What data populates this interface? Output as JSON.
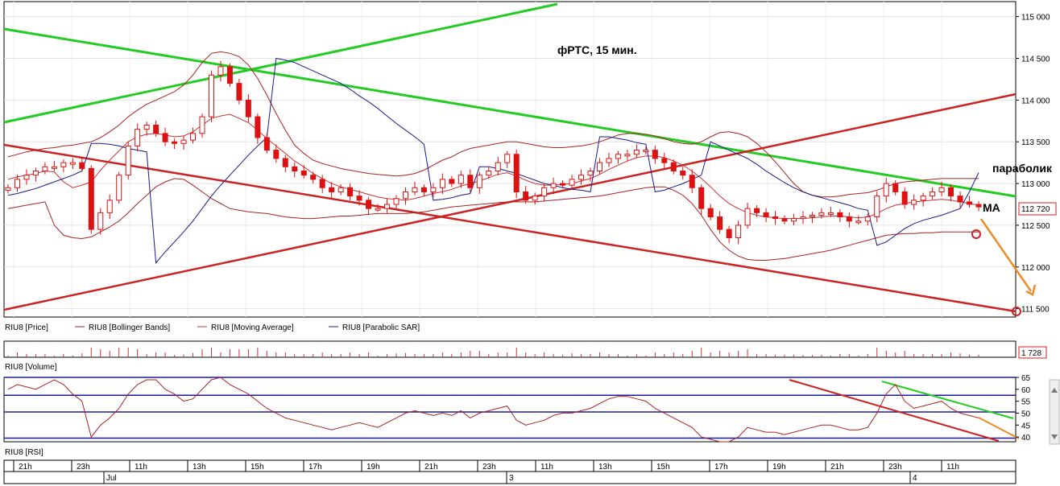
{
  "chart_data": [
    {
      "type": "candlestick",
      "title": "фРТС, 15 мин.",
      "legend": [
        "RIU8 [Price]",
        "RIU8 [Bollinger Bands]",
        "RIU8 [Moving Average]",
        "RIU8 [Parabolic SAR]"
      ],
      "y_ticks": [
        "115 000",
        "114 500",
        "114 000",
        "113 500",
        "113 000",
        "112 500",
        "112 000",
        "111 500"
      ],
      "ylim": [
        111400,
        115180
      ],
      "last_value": "112 720",
      "annotations": [
        "параболик",
        "MA"
      ],
      "colors": {
        "candles": "#dd1111",
        "bollinger": "#aa2222",
        "moving_average": "#cc3333",
        "parabolic_sar": "#1a1a8c",
        "trend_green": "#22cc22",
        "trend_red": "#cc2222",
        "forecast_arrow": "#f08a24"
      },
      "price_series": [
        112950,
        113050,
        113100,
        113150,
        113200,
        113200,
        113250,
        113250,
        113180,
        112450,
        112650,
        112800,
        113100,
        113450,
        113650,
        113700,
        113600,
        113500,
        113480,
        113520,
        113600,
        113800,
        114300,
        114400,
        114200,
        114000,
        113800,
        113550,
        113400,
        113300,
        113200,
        113150,
        113100,
        113050,
        112950,
        112900,
        112950,
        112850,
        112800,
        112700,
        112700,
        112750,
        112820,
        112900,
        112950,
        112900,
        112950,
        113050,
        113000,
        113100,
        112950,
        113100,
        113150,
        113250,
        113350,
        112900,
        112800,
        112850,
        112950,
        113000,
        112980,
        113050,
        113100,
        113150,
        113250,
        113300,
        113350,
        113350,
        113400,
        113400,
        113300,
        113250,
        113150,
        113100,
        112950,
        112700,
        112600,
        112450,
        112350,
        112500,
        112700,
        112650,
        112600,
        112580,
        112550,
        112580,
        112600,
        112620,
        112650,
        112650,
        112600,
        112550,
        112550,
        112600,
        112850,
        113000,
        112900,
        112750,
        112800,
        112850,
        112900,
        112950,
        112850,
        112780,
        112750,
        112720
      ],
      "moving_average": [
        113050,
        113080,
        113100,
        113120,
        113150,
        113140,
        113020,
        112950,
        112980,
        113020,
        113160,
        113280,
        113390,
        113500,
        113560,
        113590,
        113600,
        113580,
        113560,
        113570,
        113620,
        113700,
        113780,
        113810,
        113830,
        113780,
        113730,
        113640,
        113540,
        113450,
        113360,
        113270,
        113200,
        113120,
        113060,
        113000,
        112960,
        112930,
        112900,
        112870,
        112840,
        112820,
        112810,
        112800,
        112820,
        112850,
        112880,
        112900,
        112930,
        112970,
        113000,
        113030,
        113070,
        113110,
        113130,
        113090,
        113040,
        113000,
        112980,
        112980,
        112990,
        113000,
        113030,
        113060,
        113110,
        113170,
        113220,
        113270,
        113310,
        113330,
        113330,
        113310,
        113270,
        113220,
        113150,
        113060,
        112960,
        112850,
        112760,
        112700,
        112650,
        112620,
        112600,
        112590,
        112580,
        112580,
        112580,
        112590,
        112600,
        112610,
        112610,
        112600,
        112590,
        112600,
        112640,
        112700,
        112740,
        112760,
        112780,
        112790,
        112800,
        112810,
        112800,
        112780,
        112760,
        112740
      ],
      "bollinger_upper": [
        113320,
        113350,
        113380,
        113400,
        113420,
        113430,
        113450,
        113460,
        113480,
        113500,
        113550,
        113620,
        113700,
        113800,
        113880,
        113950,
        114000,
        114050,
        114100,
        114180,
        114300,
        114450,
        114560,
        114580,
        114560,
        114520,
        114420,
        114260,
        114060,
        113840,
        113640,
        113460,
        113360,
        113280,
        113240,
        113210,
        113180,
        113160,
        113140,
        113120,
        113110,
        113100,
        113090,
        113100,
        113120,
        113160,
        113220,
        113280,
        113320,
        113380,
        113420,
        113440,
        113460,
        113480,
        113500,
        113500,
        113480,
        113460,
        113440,
        113430,
        113430,
        113440,
        113450,
        113470,
        113500,
        113540,
        113580,
        113600,
        113600,
        113590,
        113570,
        113540,
        113500,
        113480,
        113470,
        113500,
        113560,
        113610,
        113620,
        113600,
        113560,
        113480,
        113380,
        113260,
        113130,
        113000,
        112900,
        112860,
        112840,
        112840,
        112850,
        112870,
        112880,
        112890,
        112920,
        112960,
        113000,
        113020,
        113030,
        113040,
        113050,
        113060,
        113060,
        113060,
        113060,
        113060
      ],
      "bollinger_lower": [
        112700,
        112720,
        112740,
        112760,
        112780,
        112500,
        112380,
        112350,
        112340,
        112360,
        112420,
        112480,
        112550,
        112650,
        112760,
        112860,
        112960,
        113020,
        113060,
        113050,
        112980,
        112900,
        112820,
        112760,
        112700,
        112680,
        112660,
        112650,
        112640,
        112620,
        112600,
        112590,
        112580,
        112580,
        112590,
        112600,
        112610,
        112610,
        112620,
        112630,
        112640,
        112640,
        112640,
        112640,
        112650,
        112660,
        112680,
        112700,
        112720,
        112730,
        112740,
        112750,
        112760,
        112770,
        112780,
        112780,
        112780,
        112780,
        112790,
        112800,
        112810,
        112820,
        112830,
        112840,
        112850,
        112870,
        112890,
        112910,
        112930,
        112950,
        112960,
        112960,
        112920,
        112860,
        112760,
        112620,
        112450,
        112300,
        112200,
        112130,
        112090,
        112080,
        112080,
        112090,
        112100,
        112120,
        112140,
        112160,
        112180,
        112200,
        112230,
        112260,
        112290,
        112320,
        112350,
        112380,
        112390,
        112400,
        112400,
        112410,
        112410,
        112420,
        112420,
        112420,
        112420,
        112420
      ],
      "parabolic_sar": [
        112860,
        112880,
        112910,
        112940,
        112980,
        113020,
        113060,
        113100,
        113150,
        113480,
        113480,
        113470,
        113450,
        113420,
        113400,
        113380,
        112050,
        112180,
        112300,
        112420,
        112550,
        112700,
        112850,
        112980,
        113100,
        113220,
        113340,
        113450,
        113550,
        114500,
        114480,
        114450,
        114400,
        114350,
        114300,
        114250,
        114200,
        114130,
        114050,
        113980,
        113900,
        113810,
        113720,
        113640,
        113560,
        113470,
        112800,
        112810,
        112830,
        112860,
        112880,
        113200,
        113200,
        113180,
        113150,
        113120,
        113080,
        113040,
        113000,
        112980,
        112950,
        112930,
        112920,
        112900,
        113560,
        113560,
        113540,
        113520,
        113490,
        113470,
        112900,
        112920,
        112960,
        113000,
        113050,
        113100,
        113500,
        113450,
        113400,
        113350,
        113300,
        113230,
        113150,
        113080,
        113010,
        112950,
        112900,
        112860,
        112830,
        112800,
        112770,
        112740,
        112700,
        112680,
        112260,
        112300,
        112380,
        112460,
        112520,
        112560,
        112590,
        112620,
        112660,
        112700,
        112900,
        113130
      ]
    },
    {
      "type": "bar",
      "legend": [
        "RIU8 [Volume]"
      ],
      "last_value": "1 728"
    },
    {
      "type": "line",
      "legend": [
        "RIU8 [RSI]"
      ],
      "y_ticks": [
        "65",
        "60",
        "55",
        "50",
        "45",
        "40"
      ],
      "ylim": [
        38,
        65
      ],
      "levels": [
        65,
        57.5,
        50.5,
        39.5
      ],
      "rsi_values": [
        60,
        62,
        61,
        60,
        62,
        64,
        62,
        58,
        55,
        40,
        45,
        48,
        52,
        58,
        62,
        64,
        64,
        60,
        58,
        55,
        56,
        60,
        64,
        66,
        62,
        60,
        58,
        55,
        52,
        50,
        48,
        47,
        46,
        45,
        44,
        43,
        44,
        45,
        46,
        45,
        44,
        46,
        48,
        50,
        51,
        50,
        49,
        50,
        49,
        51,
        48,
        50,
        51,
        52,
        53,
        47,
        45,
        46,
        47,
        49,
        50,
        50,
        51,
        52,
        54,
        56,
        57,
        57,
        56,
        55,
        52,
        50,
        48,
        46,
        44,
        40,
        39,
        38,
        38,
        40,
        44,
        43,
        42,
        42,
        41,
        42,
        43,
        44,
        45,
        45,
        44,
        43,
        43,
        44,
        50,
        58,
        62,
        55,
        52,
        53,
        54,
        55,
        52,
        50,
        49,
        48
      ]
    }
  ],
  "time_axis": {
    "labels": [
      "21h",
      "23h",
      "11h",
      "13h",
      "15h",
      "17h",
      "19h",
      "21h",
      "23h",
      "11h",
      "13h",
      "15h",
      "17h",
      "19h",
      "21h",
      "23h",
      "11h"
    ],
    "dates": [
      "Jul",
      "3",
      "4"
    ]
  }
}
